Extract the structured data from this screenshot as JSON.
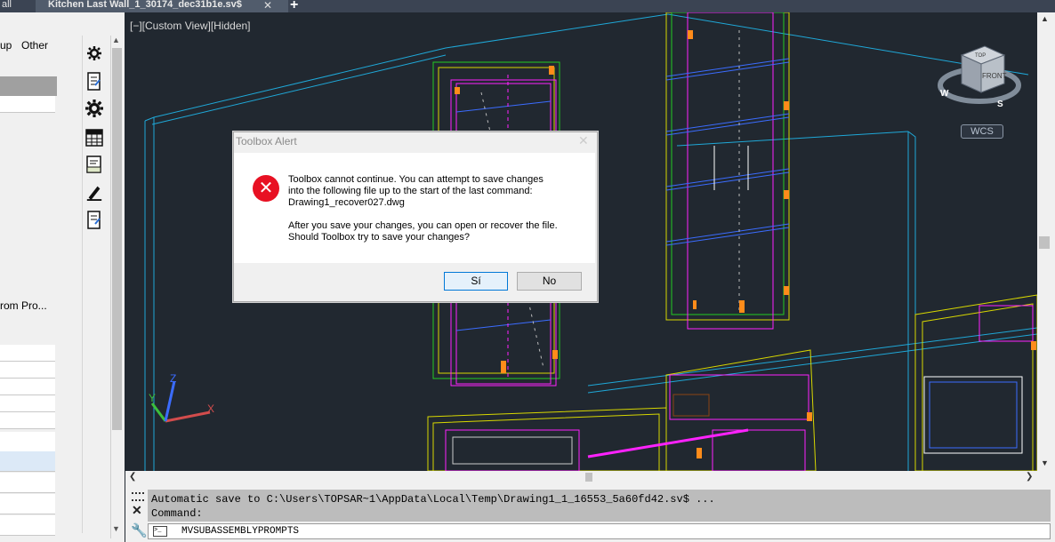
{
  "tabs": {
    "previous_label": "all",
    "active_label": "Kitchen Last Wall_1_30174_dec31b1e.sv$",
    "close_glyph": "✕",
    "new_glyph": "+"
  },
  "palette": {
    "tab_partial": "up",
    "tab_other": "Other",
    "truncated_item": "rom Pro..."
  },
  "viewport": {
    "view_label": "[−][Custom View][Hidden]",
    "viewcube_top": "TOP",
    "viewcube_front": "FRONT",
    "compass_w": "W",
    "compass_s": "S",
    "wcs_label": "WCS",
    "colors": {
      "background": "#212830",
      "cyan": "#1fa8d8",
      "magenta": "#ff22ff",
      "yellow": "#d8d800",
      "green": "#22cc22",
      "blue": "#3b6cff"
    }
  },
  "dialog": {
    "title": "Toolbox Alert",
    "line1": "Toolbox cannot continue.  You can attempt to save changes",
    "line2": "into the following file up to the start of the last command:",
    "line3": "Drawing1_recover027.dwg",
    "line4": "After you save your changes, you can open or recover the file.",
    "line5": "Should Toolbox try to save your changes?",
    "yes_label": "Sí",
    "no_label": "No",
    "icon": "error-icon"
  },
  "command": {
    "history_line1": "Automatic save to C:\\Users\\TOPSAR~1\\AppData\\Local\\Temp\\Drawing1_1_16553_5a60fd42.sv$ ...",
    "history_line2": "Command:",
    "input_value": "MVSUBASSEMBLYPROMPTS",
    "prompt_icon_text": ">_"
  }
}
